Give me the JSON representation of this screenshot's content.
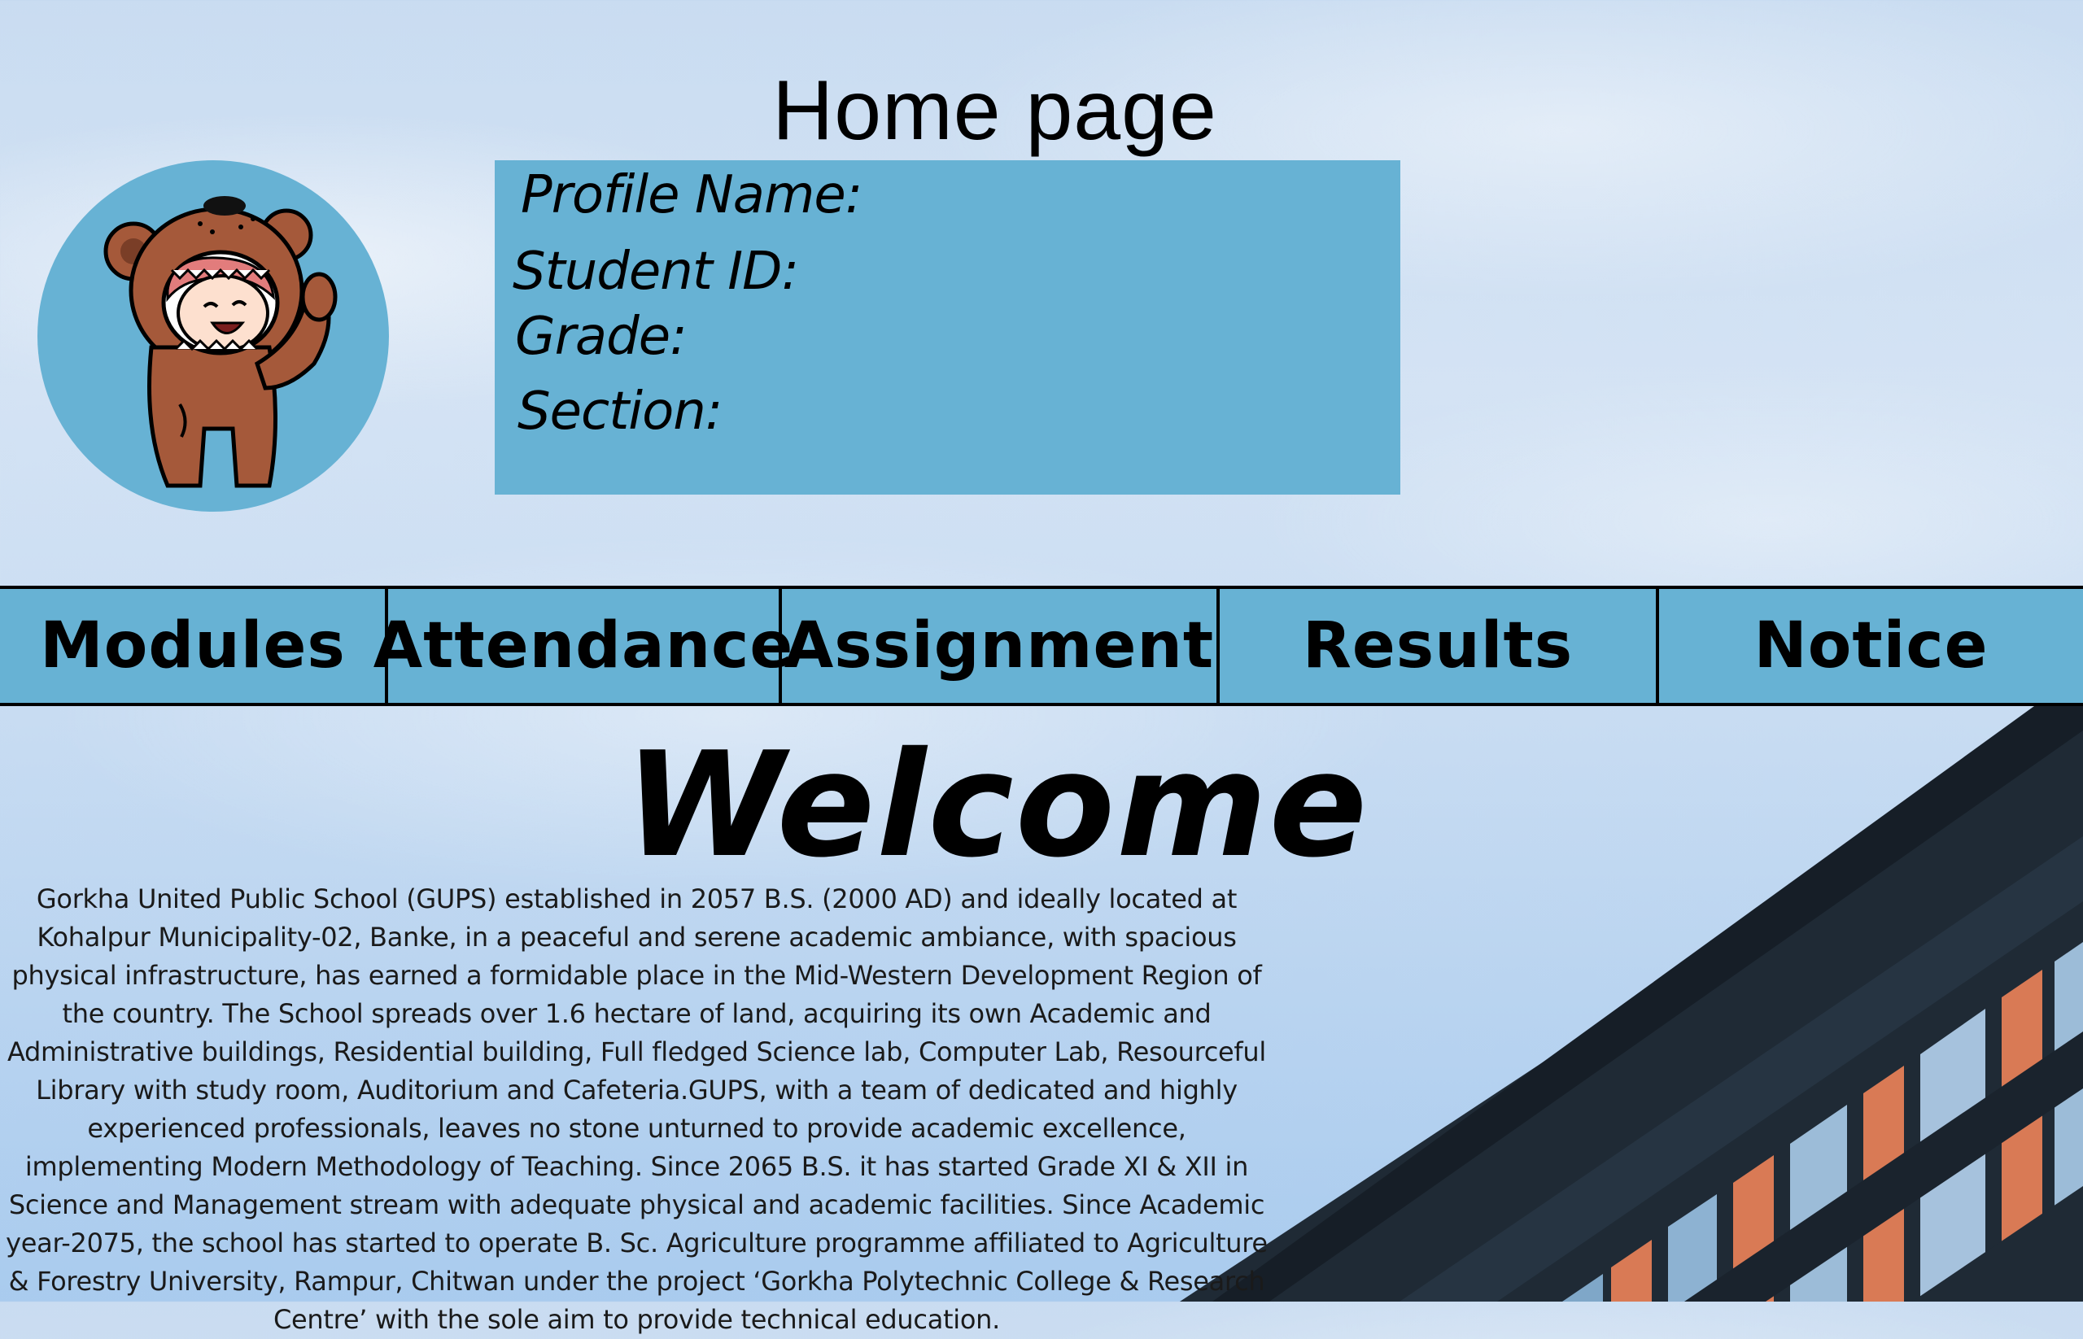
{
  "header": {
    "title": "Home page"
  },
  "avatar": {
    "icon": "bear-costume-avatar-icon",
    "bg_color": "#67b2d4"
  },
  "profile": {
    "name_label": "Profile Name:",
    "student_id_label": "Student ID:",
    "grade_label": "Grade:",
    "section_label": "Section:"
  },
  "nav": {
    "items": [
      {
        "label": "Modules"
      },
      {
        "label": "Attendance"
      },
      {
        "label": "Assignment"
      },
      {
        "label": "Results"
      },
      {
        "label": "Notice"
      }
    ]
  },
  "main": {
    "welcome": "Welcome",
    "description": "Gorkha United Public School (GUPS) established in 2057 B.S. (2000 AD) and ideally located at Kohalpur Municipality-02, Banke, in a peaceful and serene academic ambiance, with spacious physical infrastructure, has earned a formidable place in the Mid-Western Development Region of the country. The School spreads over 1.6 hectare of land, acquiring its own Academic and Administrative buildings, Residential building, Full fledged Science lab, Computer Lab, Resourceful Library with study room, Auditorium and Cafeteria.GUPS, with a team of dedicated and highly experienced professionals, leaves no stone unturned to provide academic excellence, implementing Modern Methodology of Teaching. Since 2065 B.S. it has started Grade XI & XII in Science and Management stream with adequate physical and academic facilities. Since Academic year-2075, the school has started to operate B. Sc. Agriculture programme affiliated to Agriculture & Forestry University, Rampur, Chitwan under the project ‘Gorkha Polytechnic College & Research Centre’ with the sole aim to provide technical education."
  },
  "colors": {
    "accent": "#67b2d4",
    "sky": "#c9dcf1",
    "building_dark": "#1f2a35",
    "building_orange": "#d97a55"
  }
}
